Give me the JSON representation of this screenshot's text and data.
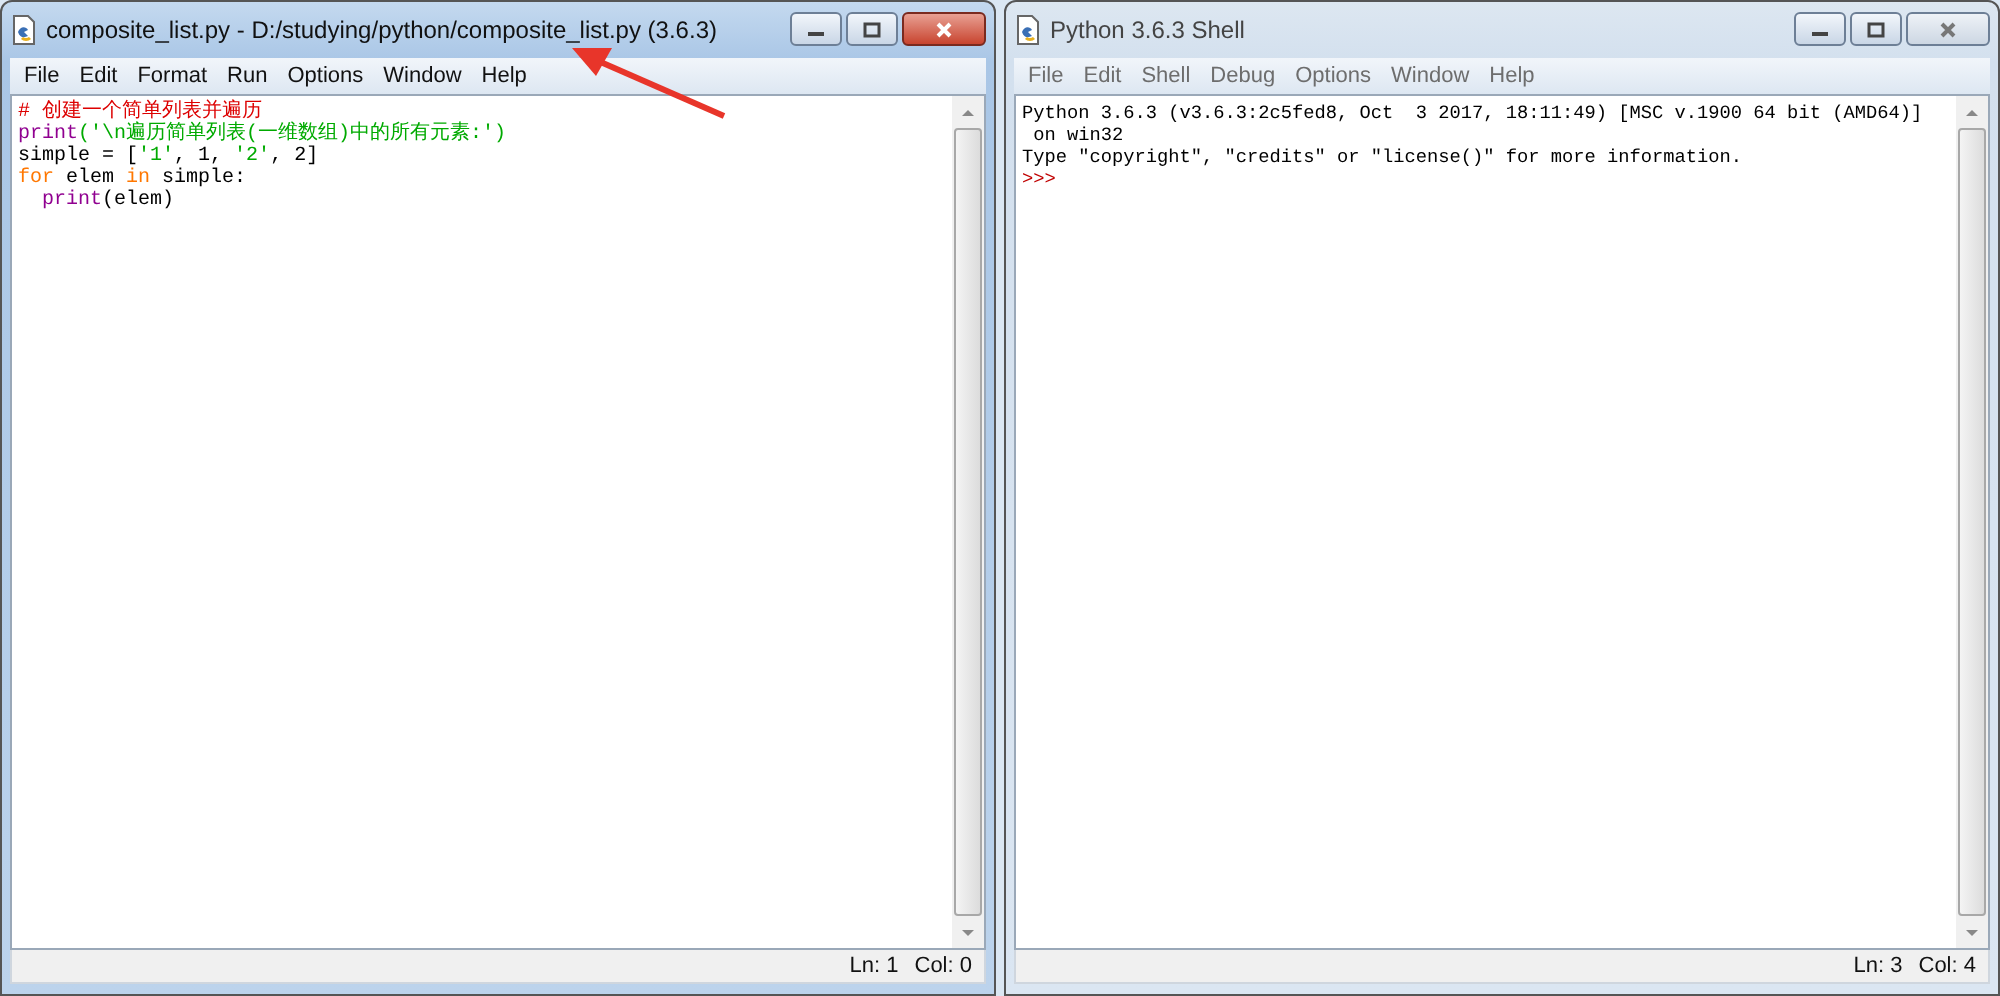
{
  "windows": [
    {
      "title": "composite_list.py - D:/studying/python/composite_list.py (3.6.3)",
      "active": true,
      "menu": [
        "File",
        "Edit",
        "Format",
        "Run",
        "Options",
        "Window",
        "Help"
      ],
      "lines": [
        [
          {
            "text": "# 创建一个简单列表并遍历",
            "kind": "comment"
          }
        ],
        [
          {
            "text": "print",
            "kind": "builtin"
          },
          {
            "text": "('\\n遍历简单列表(一维数组)中的所有元素:')",
            "kind": "string"
          }
        ],
        [
          {
            "text": "simple = [",
            "kind": "plain"
          },
          {
            "text": "'1'",
            "kind": "string"
          },
          {
            "text": ", 1, ",
            "kind": "plain"
          },
          {
            "text": "'2'",
            "kind": "string"
          },
          {
            "text": ", 2]",
            "kind": "plain"
          }
        ],
        [
          {
            "text": "for",
            "kind": "keyword"
          },
          {
            "text": " elem ",
            "kind": "plain"
          },
          {
            "text": "in",
            "kind": "keyword"
          },
          {
            "text": " simple:",
            "kind": "plain"
          }
        ],
        [
          {
            "text": "print",
            "kind": "builtin",
            "indented": true
          },
          {
            "text": "(elem)",
            "kind": "plain"
          }
        ]
      ],
      "status": {
        "ln": "Ln: 1",
        "col": "Col: 0"
      }
    },
    {
      "title": "Python 3.6.3 Shell",
      "active": false,
      "menu": [
        "File",
        "Edit",
        "Shell",
        "Debug",
        "Options",
        "Window",
        "Help"
      ],
      "lines": [
        [
          {
            "text": "Python 3.6.3 (v3.6.3:2c5fed8, Oct  3 2017, 18:11:49) [MSC v.1900 64 bit (AMD64)]",
            "kind": "plain"
          }
        ],
        [
          {
            "text": " on win32",
            "kind": "plain"
          }
        ],
        [
          {
            "text": "Type \"copyright\", \"credits\" or \"license()\" for more information.",
            "kind": "plain"
          }
        ],
        [
          {
            "text": ">>> ",
            "kind": "prompt"
          }
        ]
      ],
      "status": {
        "ln": "Ln: 3",
        "col": "Col: 4"
      }
    }
  ]
}
